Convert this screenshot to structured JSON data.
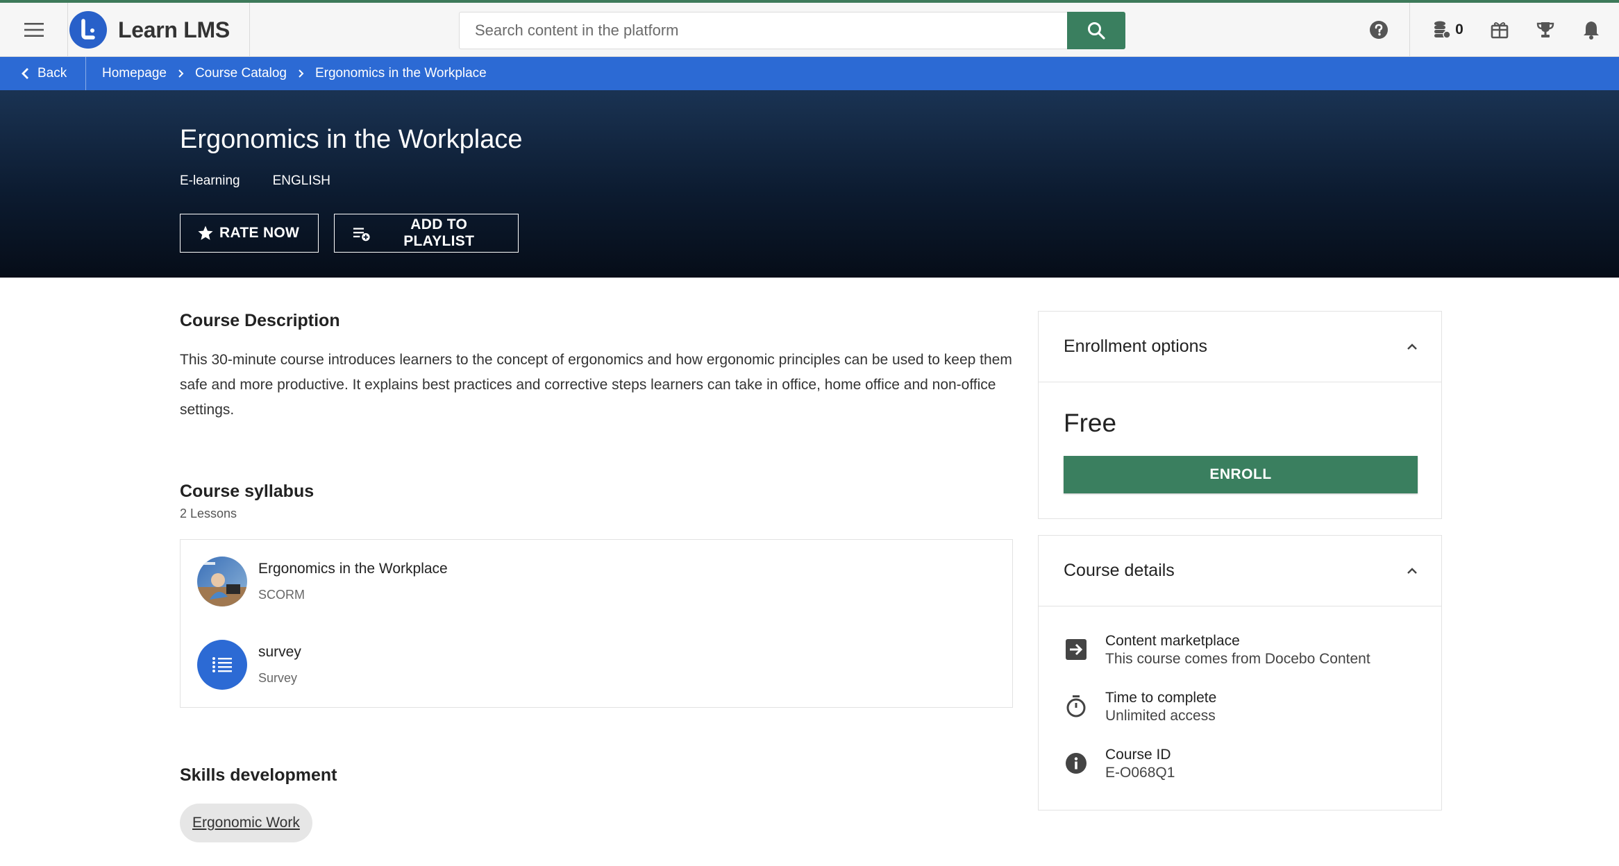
{
  "topbar": {
    "app_name": "Learn LMS",
    "search_placeholder": "Search content in the platform",
    "coins_count": "0",
    "accent_color": "#3a7f5f",
    "brand_color": "#2860c9"
  },
  "breadcrumb": {
    "back_label": "Back",
    "items": [
      "Homepage",
      "Course Catalog",
      "Ergonomics in the Workplace"
    ]
  },
  "hero": {
    "title": "Ergonomics in the Workplace",
    "type": "E-learning",
    "language": "ENGLISH",
    "rate_label": "RATE NOW",
    "playlist_label": "ADD TO PLAYLIST"
  },
  "description": {
    "heading": "Course Description",
    "text": "This 30-minute course introduces learners to the concept of ergonomics and how ergonomic principles can be used to keep them safe and more productive.  It explains best practices and corrective steps learners can take in office, home office and non-office settings."
  },
  "syllabus": {
    "heading": "Course syllabus",
    "count": "2 Lessons",
    "lessons": [
      {
        "title": "Ergonomics in the Workplace",
        "type": "SCORM",
        "icon": "course-thumbnail"
      },
      {
        "title": "survey",
        "type": "Survey",
        "icon": "list-icon"
      }
    ]
  },
  "skills": {
    "heading": "Skills development",
    "items": [
      "Ergonomic Work"
    ]
  },
  "enrollment": {
    "heading": "Enrollment options",
    "price": "Free",
    "enroll_label": "ENROLL"
  },
  "details": {
    "heading": "Course details",
    "rows": [
      {
        "label": "Content marketplace",
        "value": "This course comes from Docebo Content",
        "icon": "login-arrow-icon"
      },
      {
        "label": "Time to complete",
        "value": "Unlimited access",
        "icon": "timer-icon"
      },
      {
        "label": "Course ID",
        "value": "E-O068Q1",
        "icon": "info-icon"
      }
    ]
  }
}
